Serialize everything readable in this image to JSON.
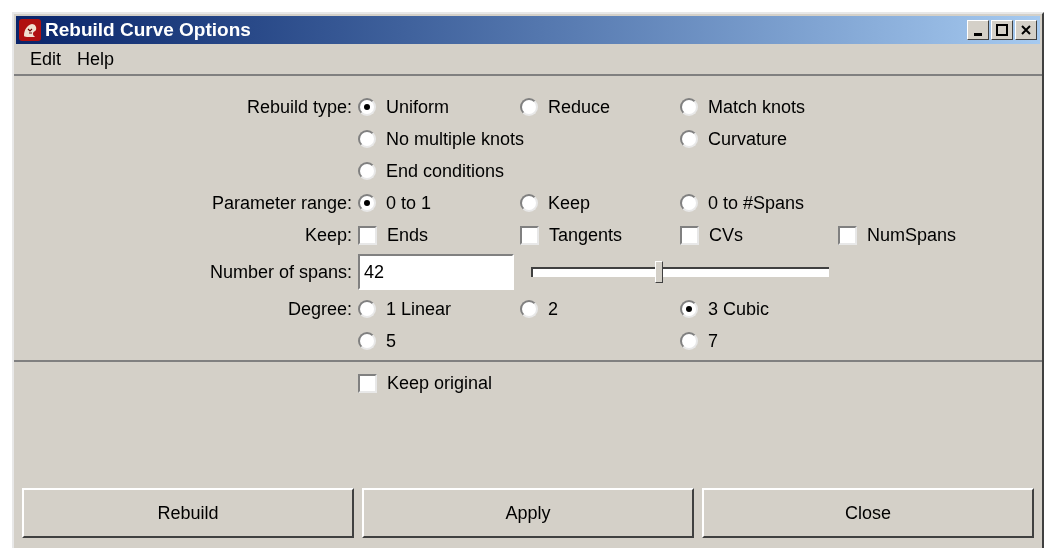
{
  "window": {
    "title": "Rebuild Curve Options"
  },
  "menu": [
    "Edit",
    "Help"
  ],
  "rebuild_type": {
    "label": "Rebuild type:",
    "rows": [
      [
        {
          "label": "Uniform",
          "selected": true
        },
        {
          "label": "Reduce",
          "selected": false
        },
        {
          "label": "Match knots",
          "selected": false
        }
      ],
      [
        {
          "label": "No multiple knots",
          "selected": false
        },
        "",
        {
          "label": "Curvature",
          "selected": false
        }
      ],
      [
        {
          "label": "End conditions",
          "selected": false
        }
      ]
    ]
  },
  "parameter_range": {
    "label": "Parameter range:",
    "rows": [
      [
        {
          "label": "0 to 1",
          "selected": true
        },
        {
          "label": "Keep",
          "selected": false
        },
        {
          "label": "0 to #Spans",
          "selected": false
        }
      ]
    ]
  },
  "keep": {
    "label": "Keep:",
    "options": [
      {
        "label": "Ends",
        "checked": false
      },
      {
        "label": "Tangents",
        "checked": false
      },
      {
        "label": "CVs",
        "checked": false
      },
      {
        "label": "NumSpans",
        "checked": false
      }
    ]
  },
  "number_of_spans": {
    "label": "Number of spans:",
    "value": "42",
    "level": 0.43
  },
  "degree": {
    "label": "Degree:",
    "rows": [
      [
        {
          "label": "1 Linear",
          "selected": false
        },
        {
          "label": "2",
          "selected": false
        },
        {
          "label": "3 Cubic",
          "selected": true
        }
      ],
      [
        {
          "label": "5",
          "selected": false
        },
        "",
        {
          "label": "7",
          "selected": false
        }
      ]
    ]
  },
  "keep_original": {
    "label": "Keep original",
    "checked": false
  },
  "buttons": [
    "Rebuild",
    "Apply",
    "Close"
  ]
}
